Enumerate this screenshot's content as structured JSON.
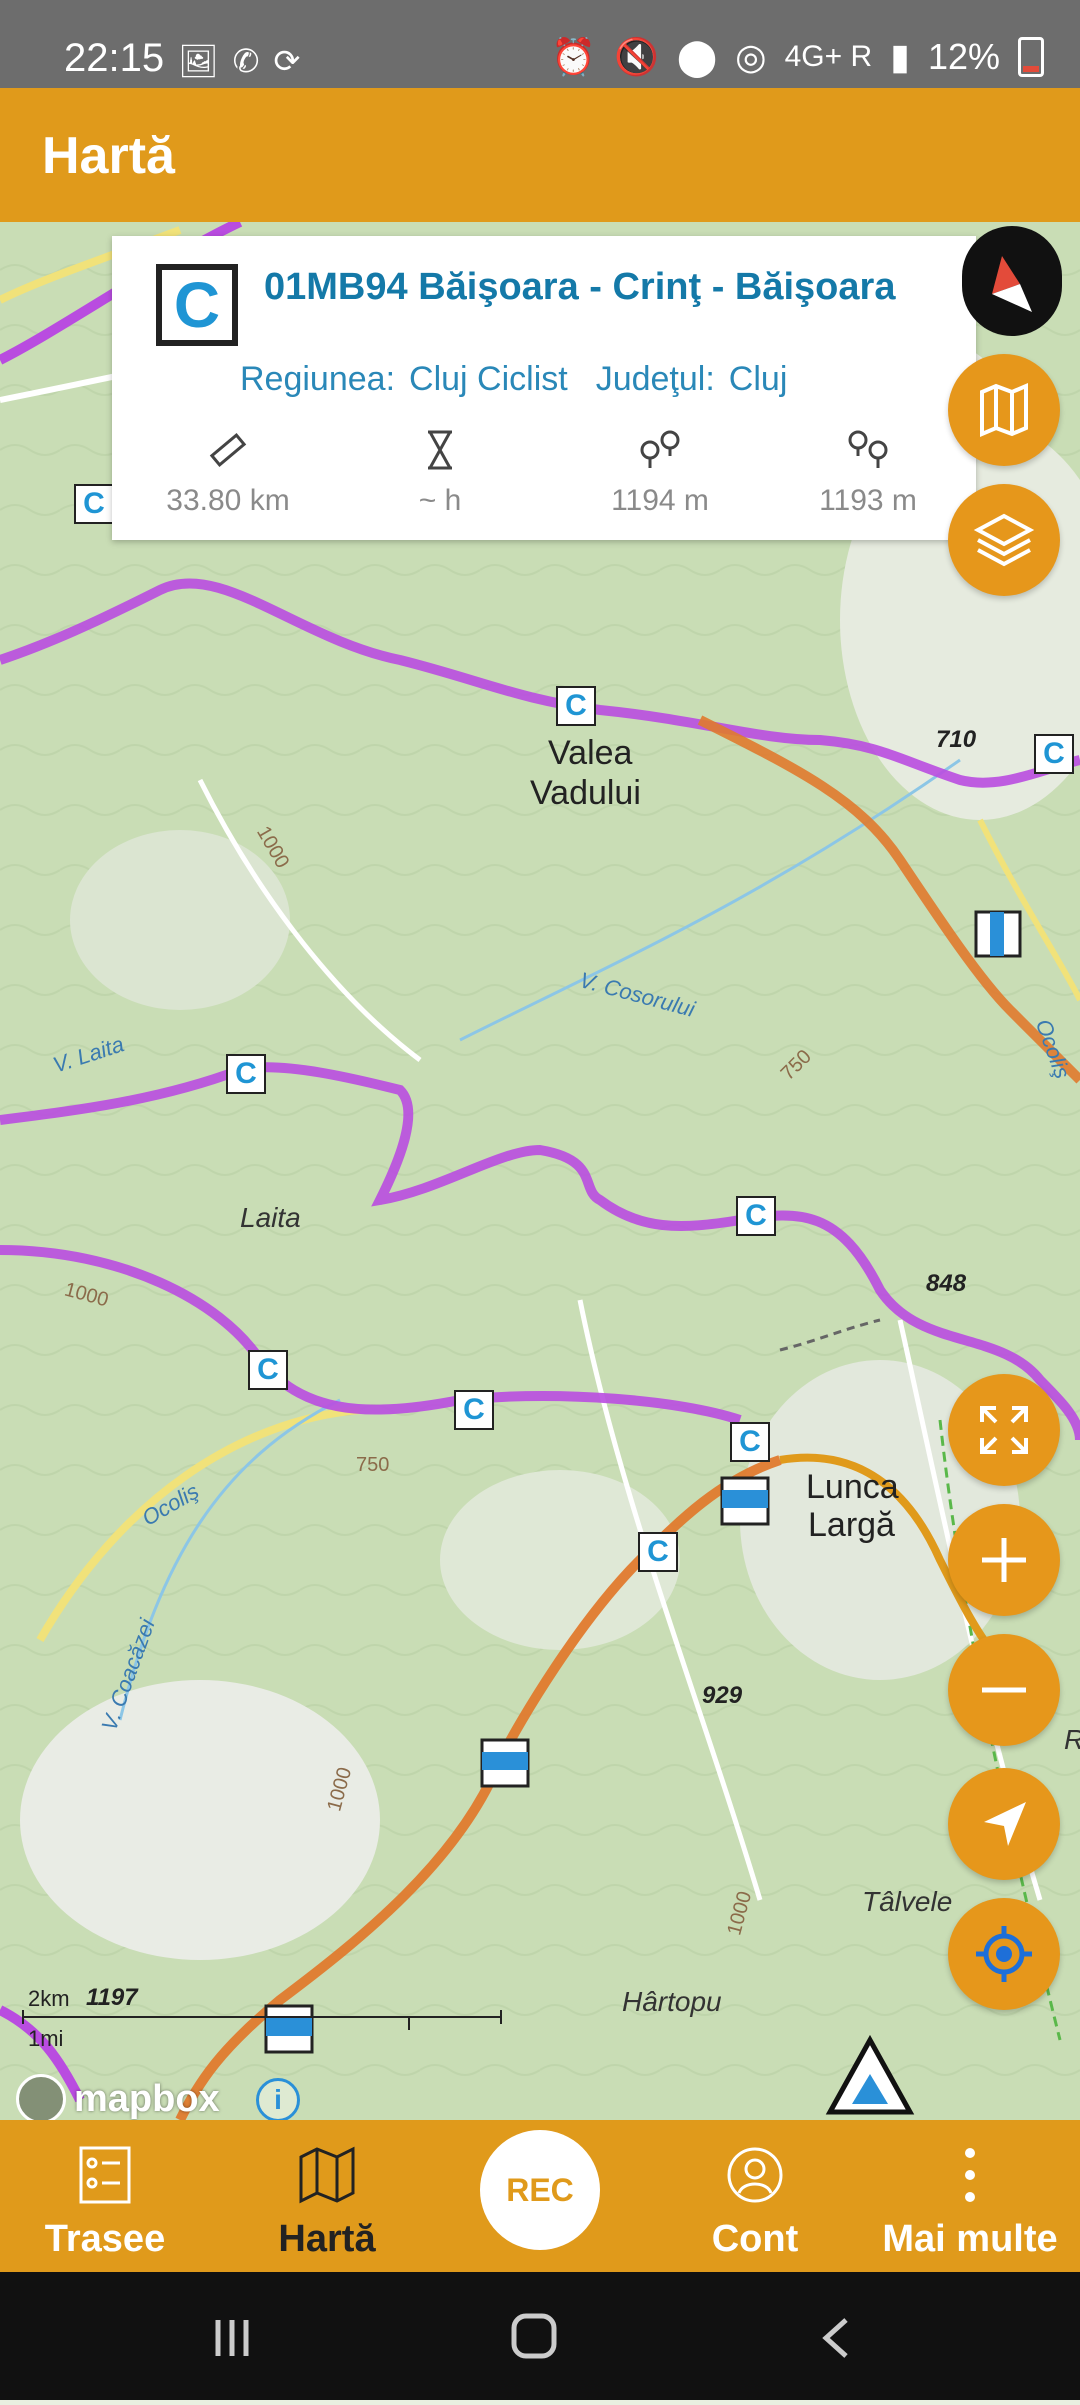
{
  "status_bar": {
    "time": "22:15",
    "left_icons": [
      "image-icon",
      "whatsapp-icon",
      "sync-icon"
    ],
    "right_icons": [
      "alarm-icon",
      "mute-icon",
      "location-icon",
      "hotspot-icon",
      "signal-icon"
    ],
    "network": "4G+ R",
    "battery": "12%"
  },
  "app_bar": {
    "title": "Hartă"
  },
  "info_card": {
    "badge": "C",
    "title": "01MB94 Băişoara - Crinţ - Băişoara",
    "region_label": "Regiunea:",
    "region_value": "Cluj Ciclist",
    "county_label": "Judeţul:",
    "county_value": "Cluj",
    "stats": [
      {
        "icon": "ruler-icon",
        "value": "33.80 km"
      },
      {
        "icon": "hourglass-icon",
        "value": "~ h"
      },
      {
        "icon": "ascent-icon",
        "value": "1194 m"
      },
      {
        "icon": "descent-icon",
        "value": "1193 m"
      }
    ]
  },
  "map": {
    "labels": {
      "valea": "Valea",
      "vadului": "Vadului",
      "lunca": "Lunca",
      "larga": "Largă",
      "laita": "Laita",
      "v_laita": "V. Laita",
      "v_cosorului": "V. Cosorului",
      "v_coacazei": "V. Coacăzei",
      "ocolis": "Ocoliş",
      "ocolis_right": "Ocoliş",
      "hartopu": "Hârtopu",
      "talvele": "Tâlvele",
      "e710": "710",
      "e848": "848",
      "e929": "929",
      "e1197": "1197",
      "c1000_a": "1000",
      "c1000_b": "1000",
      "c1000_c": "1000",
      "c1000_d": "1000",
      "c750_a": "750",
      "c750_b": "750",
      "edge_r": "R"
    },
    "route_marker": "C",
    "scale_km": "2km",
    "scale_mi": "1mi",
    "attribution": "mapbox",
    "info_symbol": "i"
  },
  "controls": [
    "compass-icon",
    "map-icon",
    "layers-icon",
    "fullscreen-icon",
    "zoom-in-icon",
    "zoom-out-icon",
    "navigate-icon",
    "my-location-icon"
  ],
  "bottom_nav": {
    "items": [
      {
        "label": "Trasee",
        "icon": "list-icon"
      },
      {
        "label": "Hartă",
        "icon": "map-icon"
      },
      {
        "label": "Cont",
        "icon": "user-icon"
      },
      {
        "label": "Mai multe",
        "icon": "more-icon"
      }
    ],
    "rec": "REC"
  },
  "colors": {
    "accent": "#e09a1b",
    "route_purple": "#b94ce0",
    "route_orange": "#e07a2e",
    "title_blue": "#1479a8"
  }
}
